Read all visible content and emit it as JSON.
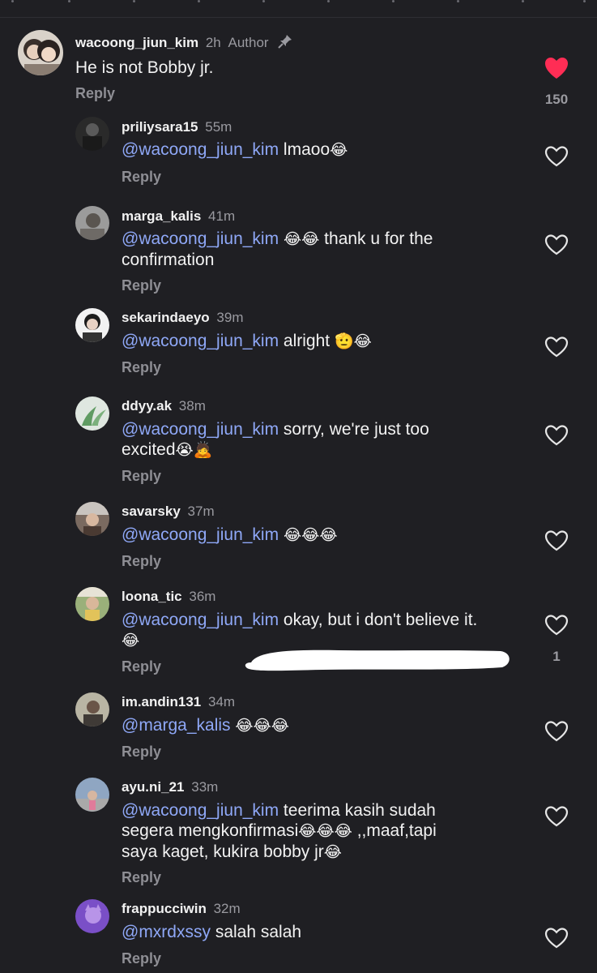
{
  "top": {
    "main": {
      "username": "wacoong_jiun_kim",
      "time": "2h",
      "author_label": "Author",
      "text": "He is not Bobby jr.",
      "reply_label": "Reply",
      "like_count": "150",
      "liked": true,
      "like_color": "#ff2d55"
    }
  },
  "replies": [
    {
      "username": "priliysara15",
      "time": "55m",
      "mention": "@wacoong_jiun_kim",
      "text_line1": " lmaoo",
      "emoji1": "😂",
      "reply_label": "Reply"
    },
    {
      "username": "marga_kalis",
      "time": "41m",
      "mention": "@wacoong_jiun_kim",
      "emoji1": "😂😂",
      "text_line1": " thank u for the",
      "text_line2": "confirmation",
      "reply_label": "Reply"
    },
    {
      "username": "sekarindaeyo",
      "time": "39m",
      "mention": "@wacoong_jiun_kim",
      "text_line1": " alright ",
      "emoji1": "🫡😂",
      "reply_label": "Reply"
    },
    {
      "username": "ddyy.ak",
      "time": "38m",
      "mention": "@wacoong_jiun_kim",
      "text_line1": " sorry, we're just too",
      "text_line2": "excited",
      "emoji2": "😭🙇",
      "reply_label": "Reply"
    },
    {
      "username": "savarsky",
      "time": "37m",
      "mention": "@wacoong_jiun_kim",
      "emoji1": "😂😂😂",
      "reply_label": "Reply"
    },
    {
      "username": "loona_tic",
      "time": "36m",
      "mention": "@wacoong_jiun_kim",
      "text_line1": " okay, but i don't believe it.",
      "emoji2": "😂",
      "reply_label": "Reply",
      "like_count": "1"
    },
    {
      "username": "im.andin131",
      "time": "34m",
      "mention": "@marga_kalis",
      "emoji1": "😂😂😂",
      "reply_label": "Reply"
    },
    {
      "username": "ayu.ni_21",
      "time": "33m",
      "mention": "@wacoong_jiun_kim",
      "text_line1": " teerima kasih sudah",
      "text_line2": "segera mengkonfirmasi",
      "emoji2": "😂😂😂",
      "text_line2b": " ,,maaf,tapi",
      "text_line3": "saya kaget, kukira bobby jr",
      "emoji3": "😂",
      "reply_label": "Reply"
    },
    {
      "username": "frappucciwin",
      "time": "32m",
      "mention": "@mxrdxssy",
      "text_line1": " salah salah",
      "reply_label": "Reply"
    }
  ],
  "colors": {
    "background": "#1f1f23",
    "mention": "#8fa8f7",
    "muted": "#9a9aa0",
    "heart_outline": "#e6e6e6"
  },
  "icons": {
    "pin": "pin-icon",
    "heart_filled": "heart-filled-icon",
    "heart_outline": "heart-outline-icon"
  }
}
